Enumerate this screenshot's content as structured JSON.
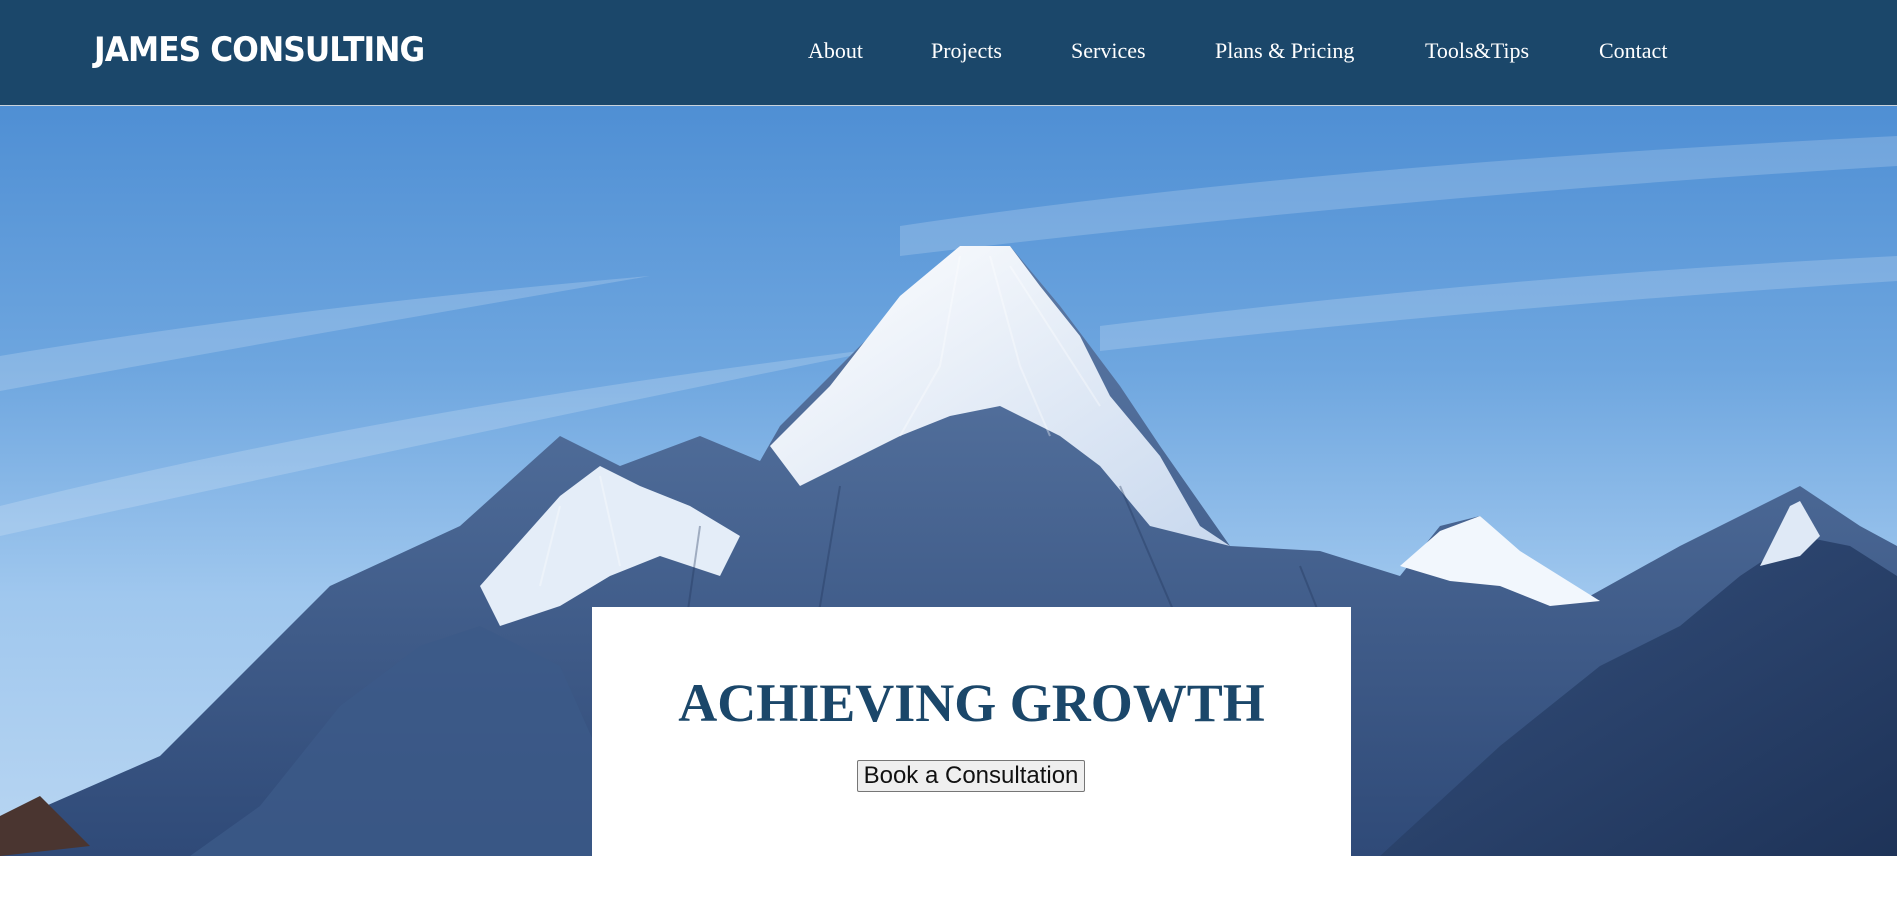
{
  "header": {
    "brand": "JAMES CONSULTING",
    "nav": [
      {
        "label": "About"
      },
      {
        "label": "Projects"
      },
      {
        "label": "Services"
      },
      {
        "label": "Plans & Pricing"
      },
      {
        "label": "Tools&Tips"
      },
      {
        "label": "Contact"
      }
    ]
  },
  "hero": {
    "image": "snow-capped mountain peak under blue sky",
    "title": "ACHIEVING GROWTH",
    "cta_label": "Book a Consultation"
  },
  "colors": {
    "nav_background": "#1b476a",
    "title_text": "#1b476a",
    "sky": "#6ea6df"
  }
}
